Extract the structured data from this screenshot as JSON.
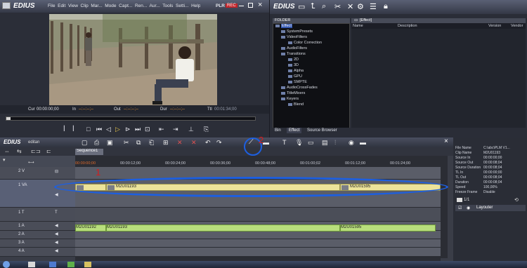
{
  "player": {
    "app_name": "EDIUS",
    "menus": [
      "File",
      "Edit",
      "View",
      "Clip",
      "Mar...",
      "Mode",
      "Capt...",
      "Ren...",
      "Aur...",
      "Tools",
      "Setti...",
      "Help"
    ],
    "mode_label": "PLR",
    "rec_label": "REC",
    "timecodes": {
      "cur_label": "Cur",
      "cur_value": "00:00:00;00",
      "in_label": "In",
      "in_value": "--:--:--;--",
      "out_label": "Out",
      "out_value": "--:--:--;--",
      "dur_label": "Dur",
      "dur_value": "--:--:--;--",
      "ttl_label": "Ttl",
      "ttl_value": "00:01:34;00"
    },
    "position_fraction": 0.0
  },
  "bin": {
    "app_name": "EDIUS",
    "folder_header": "FOLDER",
    "tree": [
      {
        "label": "Effect",
        "indent": 0
      },
      {
        "label": "SystemPresets",
        "indent": 1
      },
      {
        "label": "VideoFilters",
        "indent": 1
      },
      {
        "label": "Color Correction",
        "indent": 2
      },
      {
        "label": "AudioFilters",
        "indent": 1
      },
      {
        "label": "Transitions",
        "indent": 1
      },
      {
        "label": "2D",
        "indent": 2
      },
      {
        "label": "3D",
        "indent": 2
      },
      {
        "label": "Alpha",
        "indent": 2
      },
      {
        "label": "GPU",
        "indent": 2
      },
      {
        "label": "SMPTE",
        "indent": 2
      },
      {
        "label": "AudioCrossFades",
        "indent": 1
      },
      {
        "label": "TitleMixers",
        "indent": 1
      },
      {
        "label": "Keyers",
        "indent": 1
      },
      {
        "label": "Blend",
        "indent": 2
      }
    ],
    "content_header": "[Effect]",
    "columns": [
      "Name",
      "Description",
      "Version",
      "Vendor"
    ],
    "tabs": [
      "Bin",
      "Effect",
      "Source Browser"
    ],
    "active_tab": "Effect"
  },
  "timeline": {
    "app_name": "EDIUS",
    "project": "editan",
    "sequence_tab": "Sequence1",
    "ruler": [
      "00:00:00;00",
      "00:00:12;00",
      "00:00:24;00",
      "00:00:36;00",
      "00:00:48;00",
      "00:01:00;02",
      "00:01:12;00",
      "00:01:24;00"
    ],
    "tracks": [
      "2 V",
      "1 VA",
      "1 T",
      "1 A",
      "2 A",
      "3 A",
      "4 A"
    ],
    "video_clips": [
      "M2U01193",
      "M2U01595"
    ],
    "audio_clips": [
      "M2U01192",
      "M2U01193",
      "M2U01595"
    ]
  },
  "info": {
    "rows": [
      {
        "label": "File Name",
        "value": "C:\\abc\\PLM V1..."
      },
      {
        "label": "Clip Name",
        "value": "M2U01193"
      },
      {
        "label": "Source In",
        "value": "00:00:00;00"
      },
      {
        "label": "Source Out",
        "value": "00:00:08;04"
      },
      {
        "label": "Source Duration",
        "value": "00:00:08;04"
      },
      {
        "label": "TL In",
        "value": "00:00:00;00"
      },
      {
        "label": "TL Out",
        "value": "00:00:08;04"
      },
      {
        "label": "Duration",
        "value": "00:00:08;04"
      },
      {
        "label": "Speed",
        "value": "100,00%"
      },
      {
        "label": "Freeze Frame",
        "value": "Disable"
      }
    ],
    "page": "1/1",
    "layouter_label": "Layouter"
  },
  "annotations": {
    "mark1": "1",
    "mark2": "2"
  },
  "colors": {
    "ellipse": "#1d5fe0",
    "number": "#d81b1b",
    "video_clip": "#ece39a",
    "audio_clip": "#b8de7c",
    "rec": "#c0242a"
  }
}
